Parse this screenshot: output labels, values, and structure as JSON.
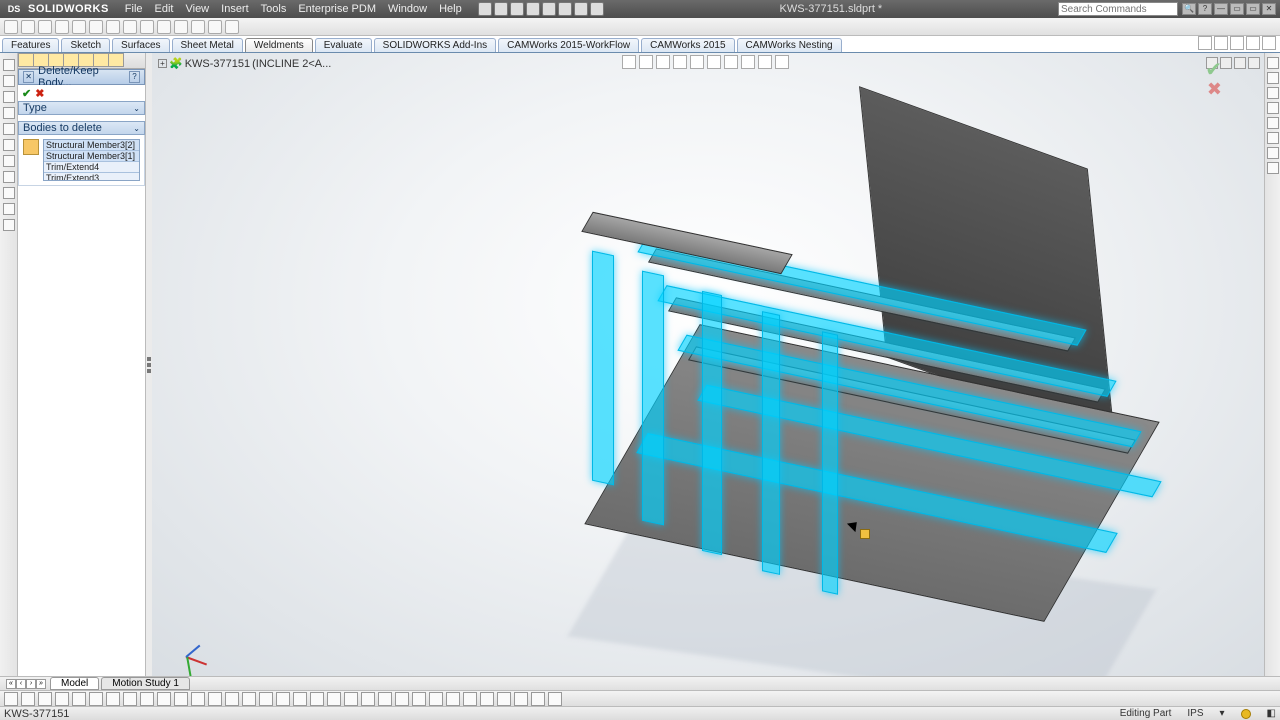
{
  "title": {
    "brand": "SOLIDWORKS",
    "document": "KWS-377151.sldprt *"
  },
  "menu": {
    "file": "File",
    "edit": "Edit",
    "view": "View",
    "insert": "Insert",
    "tools": "Tools",
    "epdm": "Enterprise PDM",
    "window": "Window",
    "help": "Help"
  },
  "search": {
    "placeholder": "Search Commands"
  },
  "ribbon_tabs": {
    "features": "Features",
    "sketch": "Sketch",
    "surfaces": "Surfaces",
    "sheetmetal": "Sheet Metal",
    "weldments": "Weldments",
    "evaluate": "Evaluate",
    "addins": "SOLIDWORKS Add-Ins",
    "camwf": "CAMWorks 2015-WorkFlow",
    "cam": "CAMWorks 2015",
    "camnest": "CAMWorks Nesting"
  },
  "propmgr": {
    "title": "Delete/Keep Body...",
    "section_type": "Type",
    "section_bodies": "Bodies to delete",
    "items": [
      "Structural Member3[2]",
      "Structural Member3[1]",
      "Trim/Extend4",
      "Trim/Extend3"
    ]
  },
  "flyout": {
    "part": "KWS-377151",
    "config": "(INCLINE 2<A..."
  },
  "model_tabs": {
    "model": "Model",
    "motion": "Motion Study 1"
  },
  "status": {
    "left": "KWS-377151",
    "mode": "Editing Part",
    "units": "IPS"
  }
}
